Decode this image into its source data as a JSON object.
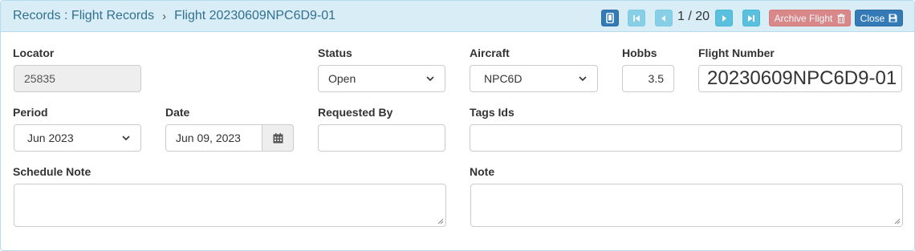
{
  "header": {
    "breadcrumb_root": "Records : Flight Records",
    "breadcrumb_sep": "›",
    "breadcrumb_current": "Flight 20230609NPC6D9-01",
    "pager_text": "1 / 20",
    "archive_label": "Archive Flight",
    "close_label": "Close"
  },
  "form": {
    "locator": {
      "label": "Locator",
      "value": "25835"
    },
    "status": {
      "label": "Status",
      "value": "Open"
    },
    "aircraft": {
      "label": "Aircraft",
      "value": "NPC6D"
    },
    "hobbs": {
      "label": "Hobbs",
      "value": "3.5"
    },
    "flight_number": {
      "label": "Flight Number",
      "value": "20230609NPC6D9-01"
    },
    "period": {
      "label": "Period",
      "value": "Jun 2023"
    },
    "date": {
      "label": "Date",
      "value": "Jun 09, 2023"
    },
    "requested_by": {
      "label": "Requested By",
      "value": ""
    },
    "tags_ids": {
      "label": "Tags Ids",
      "value": ""
    },
    "schedule_note": {
      "label": "Schedule Note",
      "value": ""
    },
    "note": {
      "label": "Note",
      "value": ""
    }
  },
  "icons": {
    "mobile": "mobile-icon",
    "first": "step-backward-icon",
    "prev": "triangle-left-icon",
    "next": "triangle-right-icon",
    "last": "step-forward-icon",
    "trash": "trash-icon",
    "save": "save-icon",
    "calendar": "calendar-icon",
    "chevron": "chevron-down-icon"
  },
  "colors": {
    "header_bg": "#d9edf7",
    "header_text": "#31708f",
    "primary": "#337ab7",
    "info": "#5bc0de",
    "danger": "#d9534f"
  }
}
